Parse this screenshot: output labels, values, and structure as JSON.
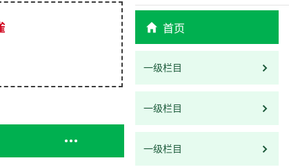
{
  "left_panel": {
    "red_text_fragment": "雀"
  },
  "nav": {
    "home_label": "首页",
    "home_icon": "home-icon",
    "items": [
      {
        "label": "一级栏目",
        "icon": "chevron-right-icon"
      },
      {
        "label": "一级栏目",
        "icon": "chevron-right-icon"
      },
      {
        "label": "一级栏目",
        "icon": "chevron-right-icon"
      }
    ]
  },
  "toolbar": {
    "more_icon": "more-horizontal-icon"
  },
  "colors": {
    "accent_green": "#00b050",
    "item_background": "#e6fbef",
    "item_text": "#1c5a3a",
    "fragment_red": "#d0021b"
  }
}
